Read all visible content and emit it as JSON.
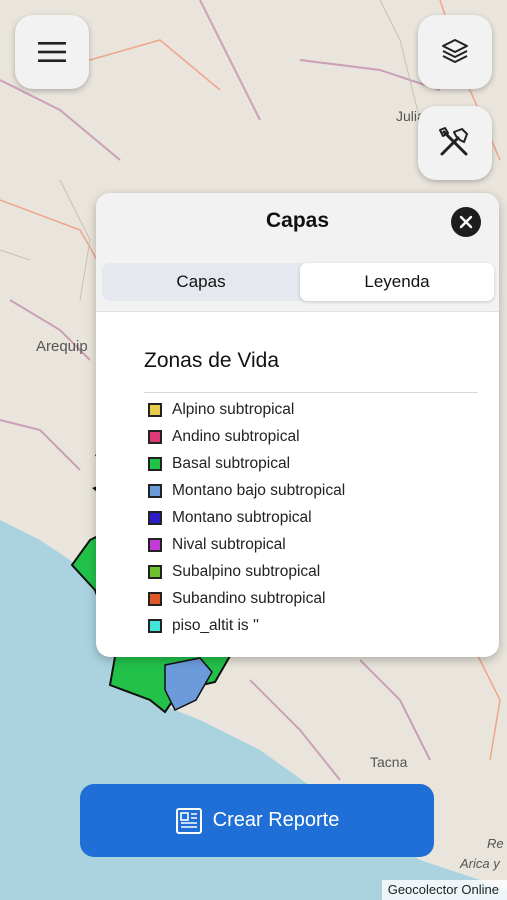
{
  "map": {
    "place_labels": [
      "Arequip",
      "Julia",
      "Tacna",
      "Arica y",
      "Re"
    ],
    "colors": {
      "land": "#e9e5dc",
      "sea": "#aad3df",
      "zone_green": "#22c24a",
      "zone_blue": "#6c9bdc"
    }
  },
  "controls": {
    "menu_icon": "hamburger-icon",
    "layers_icon": "layers-icon",
    "tools_icon": "tools-icon"
  },
  "panel": {
    "title": "Capas",
    "close_icon": "close-icon",
    "tabs": [
      {
        "label": "Capas",
        "active": false
      },
      {
        "label": "Leyenda",
        "active": true
      }
    ],
    "legend_title": "Zonas de Vida",
    "legend_items": [
      {
        "label": "Alpino subtropical",
        "color": "#e8cc4c"
      },
      {
        "label": "Andino subtropical",
        "color": "#de3a7a"
      },
      {
        "label": "Basal subtropical",
        "color": "#22c24a"
      },
      {
        "label": "Montano bajo subtropical",
        "color": "#6c9bdc"
      },
      {
        "label": "Montano subtropical",
        "color": "#2b1ec8"
      },
      {
        "label": "Nival subtropical",
        "color": "#c23bd6"
      },
      {
        "label": "Subalpino subtropical",
        "color": "#6cc22c"
      },
      {
        "label": "Subandino subtropical",
        "color": "#e0582a"
      },
      {
        "label": "piso_altit is ''",
        "color": "#40e6d8"
      }
    ]
  },
  "report_button": {
    "label": "Crear Reporte",
    "icon": "report-document-icon",
    "color": "#1f6fd6"
  },
  "attribution": "Geocolector Online"
}
